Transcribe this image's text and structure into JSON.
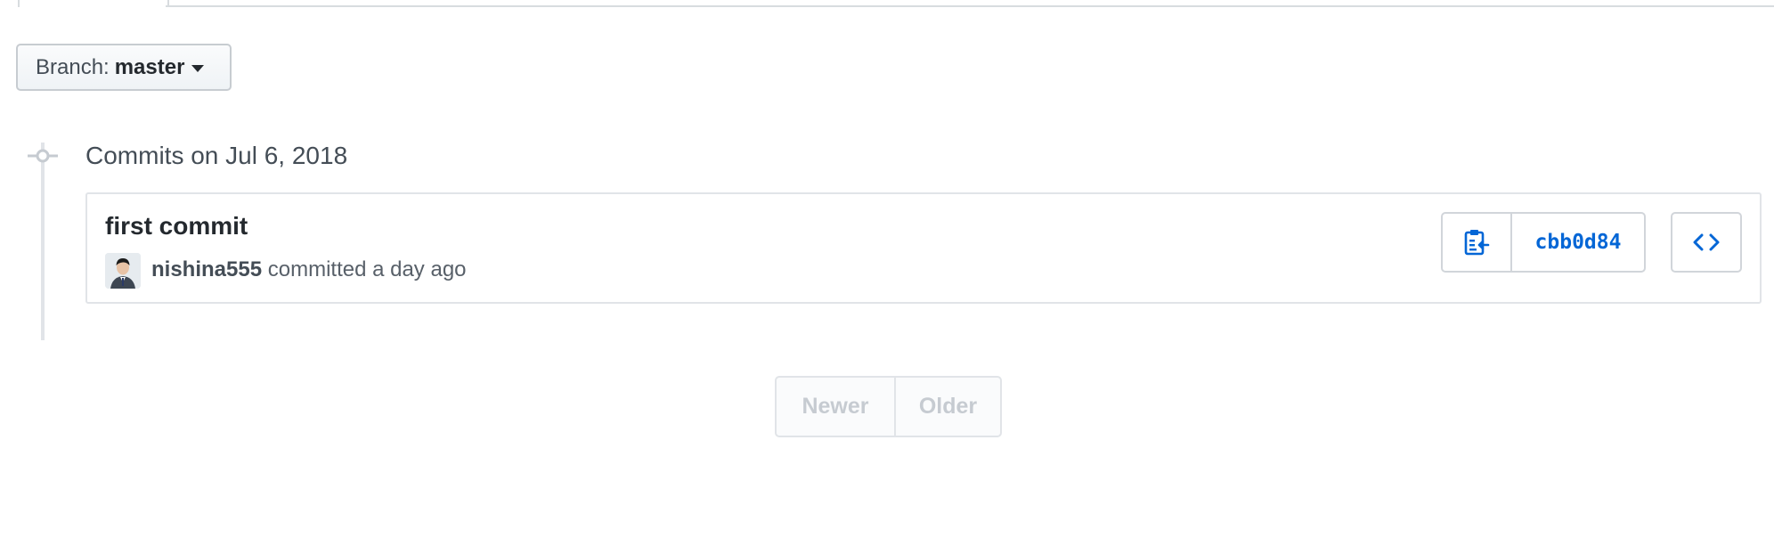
{
  "branch": {
    "label": "Branch:",
    "name": "master"
  },
  "commit_group": {
    "heading": "Commits on Jul 6, 2018"
  },
  "commit": {
    "title": "first commit",
    "author": "nishina555",
    "meta_text": "committed a day ago",
    "sha": "cbb0d84"
  },
  "pagination": {
    "newer": "Newer",
    "older": "Older"
  },
  "colors": {
    "link": "#0366d6",
    "disabled": "#c6cbd1",
    "border": "#e1e4e8"
  }
}
